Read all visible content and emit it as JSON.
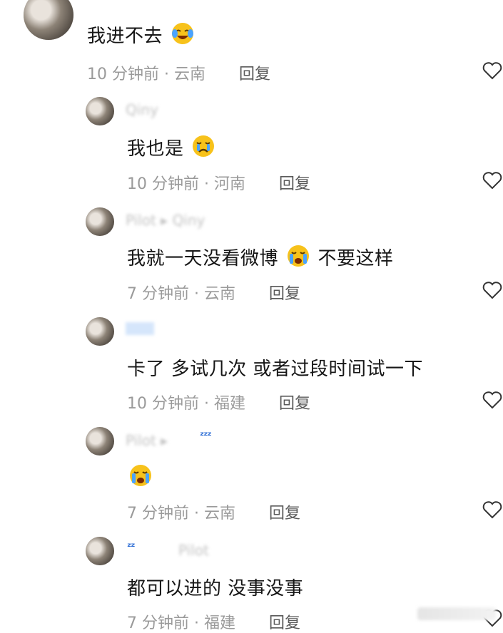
{
  "comments": [
    {
      "text": "我进不去",
      "emoji": "face-with-tears",
      "meta": "10 分钟前 · 云南",
      "reply": "回复",
      "username": "",
      "level": 0
    },
    {
      "text": "我也是",
      "emoji": "crying-face",
      "meta": "10 分钟前 · 河南",
      "reply": "回复",
      "username": "Qiny",
      "level": 1
    },
    {
      "text_before": "我就一天没看微博",
      "emoji": "loudly-crying-face",
      "text_after": "不要这样",
      "meta": "7 分钟前 · 云南",
      "reply": "回复",
      "username": "Pilot ▸ Qiny",
      "level": 1
    },
    {
      "text": "卡了 多试几次 或者过段时间试一下",
      "meta": "10 分钟前 · 福建",
      "reply": "回复",
      "username": "",
      "level": 1
    },
    {
      "text": "",
      "emoji": "loudly-crying-face",
      "meta": "7 分钟前 · 云南",
      "reply": "回复",
      "username": "Pilot ▸",
      "level": 1
    },
    {
      "text": "都可以进的 没事没事",
      "meta": "7 分钟前 · 福建",
      "reply": "回复",
      "username": "Pilot",
      "level": 1
    }
  ],
  "icons": {
    "like": "heart-outline-icon",
    "sleep": "zzz-icon"
  },
  "colors": {
    "meta": "#9a9a9a",
    "accent_blue": "#2f6fd6",
    "emoji": "#f7c21b"
  }
}
